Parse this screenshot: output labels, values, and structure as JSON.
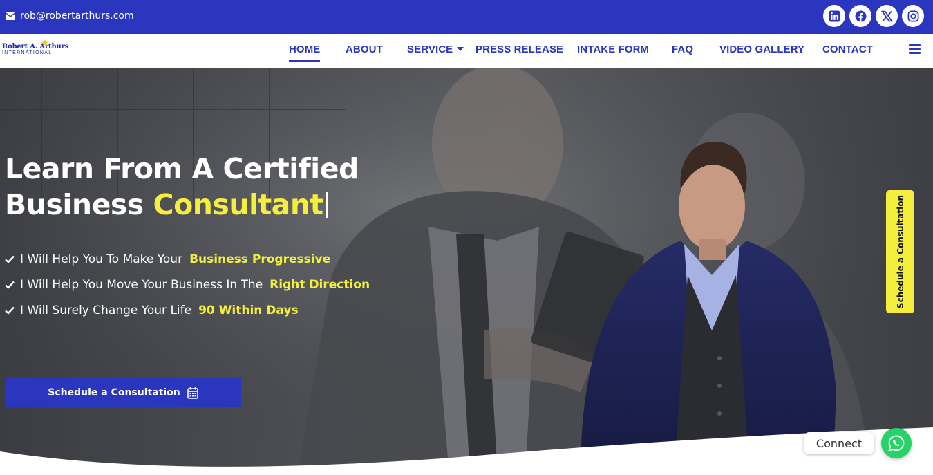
{
  "topbar": {
    "email_icon": "envelope-icon",
    "email": "rob@robertarthurs.com",
    "socials": [
      {
        "name": "linkedin-icon"
      },
      {
        "name": "facebook-icon"
      },
      {
        "name": "x-twitter-icon"
      },
      {
        "name": "instagram-icon"
      }
    ],
    "background_color": "#2a36bd"
  },
  "logo": {
    "line1": "Robert A. Arthurs",
    "line2": "INTERNATIONAL"
  },
  "nav": {
    "items": [
      {
        "label": "HOME",
        "active": true
      },
      {
        "label": "ABOUT"
      },
      {
        "label": "SERVICE",
        "has_dropdown": true
      },
      {
        "label": "PRESS RELEASE"
      },
      {
        "label": "INTAKE FORM"
      },
      {
        "label": "FAQ"
      },
      {
        "label": "VIDEO GALLERY"
      },
      {
        "label": "CONTACT"
      }
    ],
    "menu_icon": "hamburger-menu-icon"
  },
  "hero": {
    "title_line1": "Learn From A Certified",
    "title_line2_plain": "Business",
    "title_line2_highlight": "Consultant",
    "bullets": [
      {
        "text": "I Will Help You To Make Your",
        "highlight": "Business Progressive"
      },
      {
        "text": "I Will Help You Move Your Business In The",
        "highlight": "Right Direction"
      },
      {
        "text": "I Will Surely Change Your Life",
        "highlight": "90 Within Days"
      }
    ],
    "bullet_icon": "check-icon",
    "cta_label": "Schedule a Consultation",
    "cta_icon": "calendar-icon",
    "highlight_color": "#f4ef3d"
  },
  "side_tab": {
    "label": "Schedule a Consultation"
  },
  "chat": {
    "label": "Connect",
    "icon": "whatsapp-icon",
    "color": "#25d366"
  }
}
